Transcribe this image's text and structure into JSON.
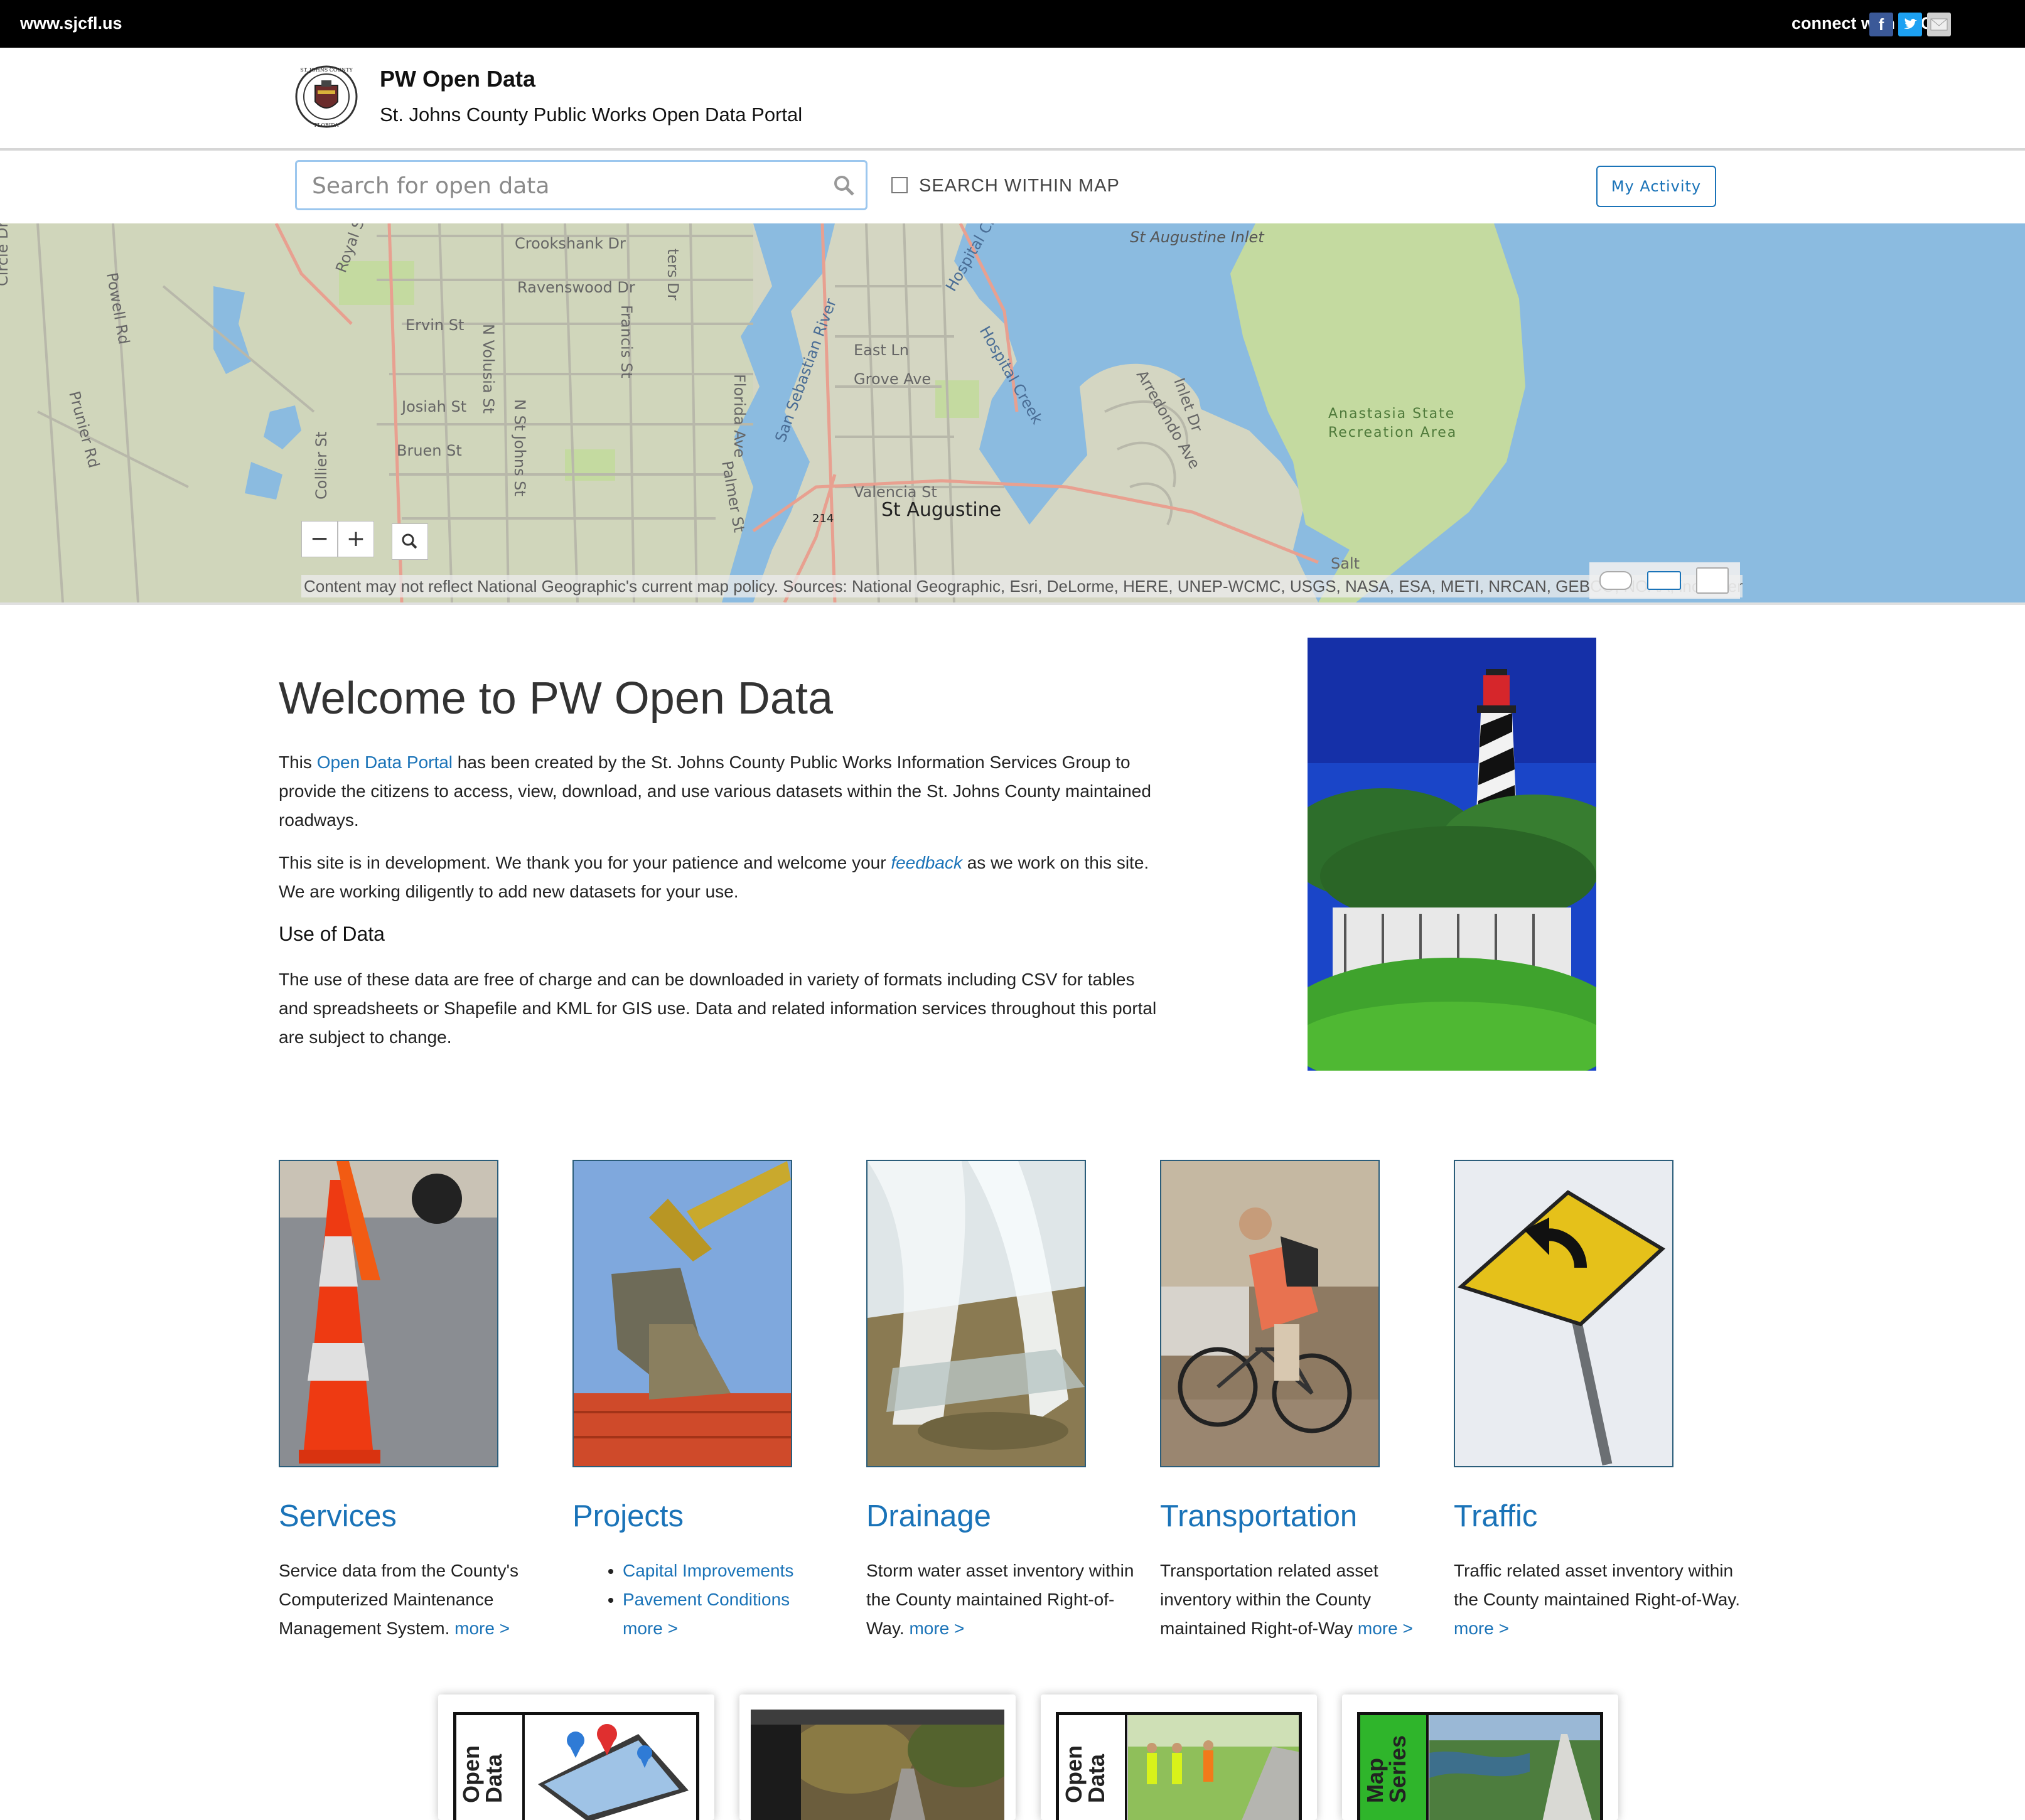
{
  "topbar": {
    "site_link": "www.sjcfl.us",
    "connect_label": "connect with SJC:",
    "social": [
      {
        "icon": "facebook-icon",
        "glyph": "f",
        "color": "#3b5998"
      },
      {
        "icon": "twitter-icon",
        "glyph": "t",
        "color": "#1da1f2"
      },
      {
        "icon": "email-icon",
        "glyph": "✉",
        "color": "#cfcfcf"
      }
    ]
  },
  "header": {
    "title": "PW Open Data",
    "subtitle": "St. Johns County Public Works Open Data Portal",
    "seal_text": "ST. JOHNS COUNTY · FLORIDA"
  },
  "search": {
    "placeholder": "Search for open data",
    "value": "",
    "within_map_label": "SEARCH WITHIN MAP",
    "within_map_checked": false,
    "my_activity_label": "My Activity"
  },
  "map": {
    "zoom_out_label": "−",
    "zoom_in_label": "+",
    "labels": {
      "crookshank": "Crookshank Dr",
      "ravenswood": "Ravenswood Dr",
      "ervin": "Ervin St",
      "josiah": "Josiah St",
      "bruen": "Bruen St",
      "collier": "Collier St",
      "n_volusia": "N Volusia St",
      "n_st_johns": "N St Johns St",
      "francis": "Francis St",
      "florida_ave": "Florida Ave",
      "palmer": "Palmer St",
      "powell": "Powell Rd",
      "prunier": "Prunier Rd",
      "royal": "Royal St",
      "circle": "Circle Dr",
      "ters": "ters Dr",
      "east_ln": "East Ln",
      "grove": "Grove Ave",
      "valencia": "Valencia St",
      "san_sebastian": "San Sebastian River",
      "hospital_creek": "Hospital Creek",
      "hospital_cr": "Hospital Cr",
      "arredondo": "Arredondo Ave",
      "inlet_dr": "Inlet Dr",
      "inlet": "St Augustine Inlet",
      "park_line1": "Anastasia State",
      "park_line2": "Recreation Area",
      "city": "St Augustine",
      "route": "214",
      "salt": "Salt"
    },
    "attribution": "Content may not reflect National Geographic's current map policy. Sources: National Geographic, Esri, DeLorme, HERE, UNEP-WCMC, USGS, NASA, ESA, METI, NRCAN, GEBCO, NOAA, increment P Corp."
  },
  "welcome": {
    "heading": "Welcome to PW Open Data",
    "p1_pre": "This ",
    "p1_link": "Open Data Portal",
    "p1_post": " has been created by the St. Johns County Public Works Information Services Group to provide the citizens to access, view, download, and use various datasets within the St. Johns County maintained roadways.",
    "p2_pre": "This site is in development. We thank you for your patience and welcome your ",
    "p2_link": "feedback",
    "p2_post": " as we work on this site. We are working diligently to add new datasets for your use.",
    "use_heading": "Use of Data",
    "p3": "The use of these data are free of charge and can be downloaded in variety of formats including CSV for tables and spreadsheets or Shapefile and KML for GIS use. Data and related information services throughout this portal are subject to change."
  },
  "categories": {
    "services": {
      "title": "Services",
      "desc": "Service data from the County's Computerized Maintenance Management System.",
      "more": "more >"
    },
    "projects": {
      "title": "Projects",
      "items": [
        "Capital Improvements",
        "Pavement Conditions"
      ],
      "more": "more >"
    },
    "drainage": {
      "title": "Drainage",
      "desc": "Storm water asset inventory within the County maintained Right-of-Way.",
      "more": "more >"
    },
    "transportation": {
      "title": "Transportation",
      "desc": "Transportation related asset inventory within the County maintained Right-of-Way",
      "more": "more >"
    },
    "traffic": {
      "title": "Traffic",
      "desc": "Traffic related asset inventory within the County maintained Right-of-Way.",
      "more": "more >"
    }
  },
  "cards": [
    {
      "vertical_label": "Open Data"
    },
    {
      "vertical_label": ""
    },
    {
      "vertical_label": "Open Data"
    },
    {
      "vertical_label": "Map Series"
    }
  ],
  "colors": {
    "accent": "#1a73b8",
    "topbar": "#000000",
    "water": "#8bbbe0",
    "land": "#d4d6c2",
    "park": "#c4daa0"
  }
}
